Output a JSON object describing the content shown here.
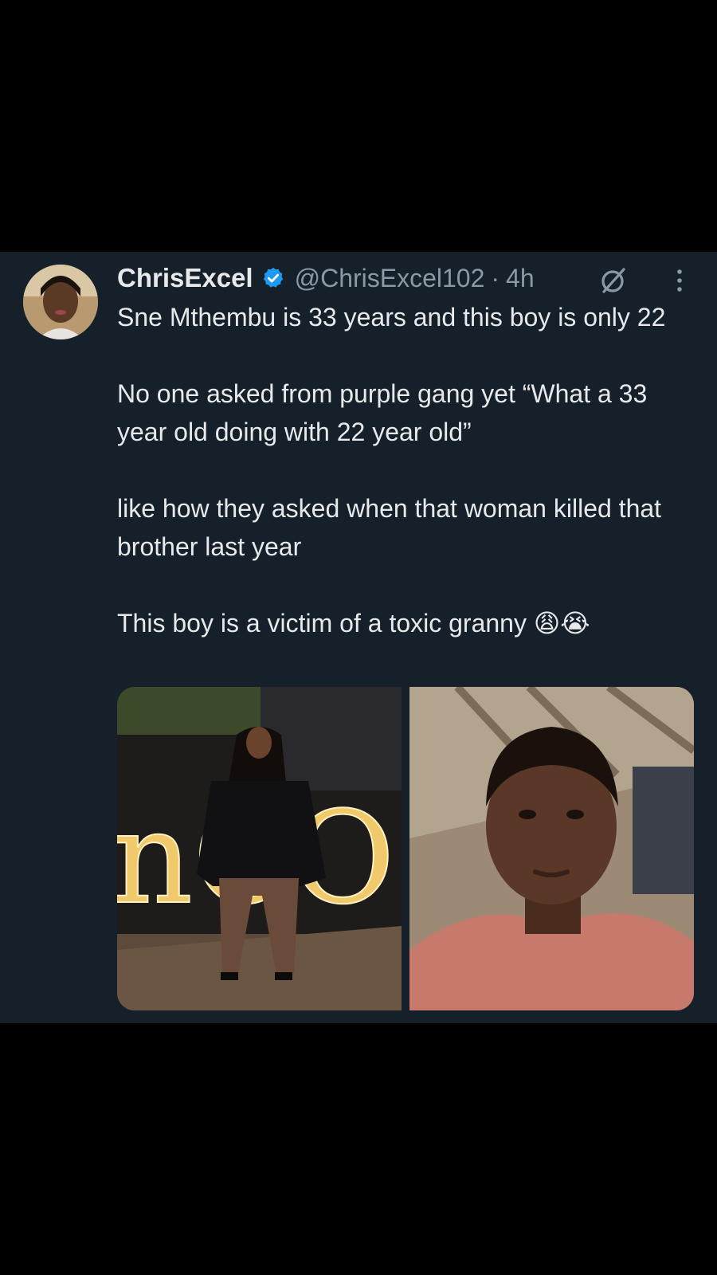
{
  "tweet": {
    "author": {
      "display_name": "ChrisExcel",
      "handle": "@ChrisExcel102",
      "separator": "·",
      "time": "4h",
      "verified": true,
      "verified_color": "#1d9bf0"
    },
    "icons": {
      "grok": "grok-icon",
      "more": "more-options-icon"
    },
    "paragraphs": [
      "Sne Mthembu is 33 years and this boy is only 22",
      "No one asked from purple gang yet “What a 33 year old doing with 22 year old”",
      "like how they asked when that woman killed that brother last year",
      "This boy is a victim of a toxic granny 😩😭"
    ],
    "media": {
      "left_sign_text": "nCOSY"
    }
  },
  "colors": {
    "background": "#000000",
    "card": "#15202b",
    "text": "#e7e9ea",
    "muted": "#8b98a5"
  }
}
